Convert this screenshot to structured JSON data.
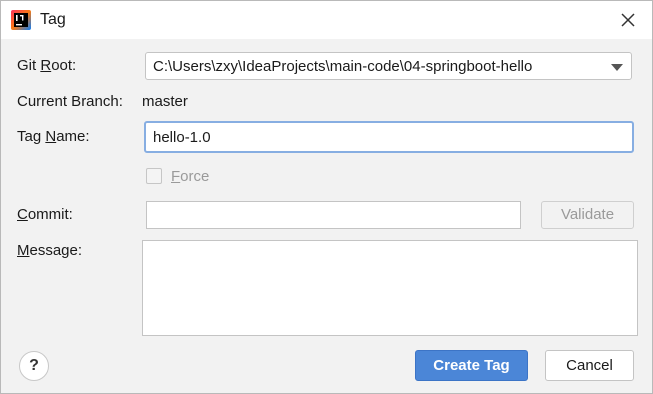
{
  "window": {
    "title": "Tag",
    "app_icon": "intellij-idea-icon",
    "close_icon": "close-icon"
  },
  "form": {
    "git_root": {
      "label_pre": "Git ",
      "label_mn": "R",
      "label_post": "oot:",
      "value": "C:\\Users\\zxy\\IdeaProjects\\main-code\\04-springboot-hello"
    },
    "current_branch": {
      "label": "Current Branch:",
      "value": "master"
    },
    "tag_name": {
      "label_pre": "Tag ",
      "label_mn": "N",
      "label_post": "ame:",
      "value": "hello-1.0"
    },
    "force": {
      "label_mn": "F",
      "label_post": "orce",
      "checked": false,
      "enabled": false
    },
    "commit": {
      "label_mn": "C",
      "label_post": "ommit:",
      "value": "",
      "validate_label": "Validate"
    },
    "message": {
      "label_mn": "M",
      "label_post": "essage:",
      "value": ""
    }
  },
  "footer": {
    "help_label": "?",
    "create_label": "Create Tag",
    "cancel_label": "Cancel"
  },
  "colors": {
    "primary_button": "#4b86d7",
    "focus_border": "#87aee2"
  }
}
